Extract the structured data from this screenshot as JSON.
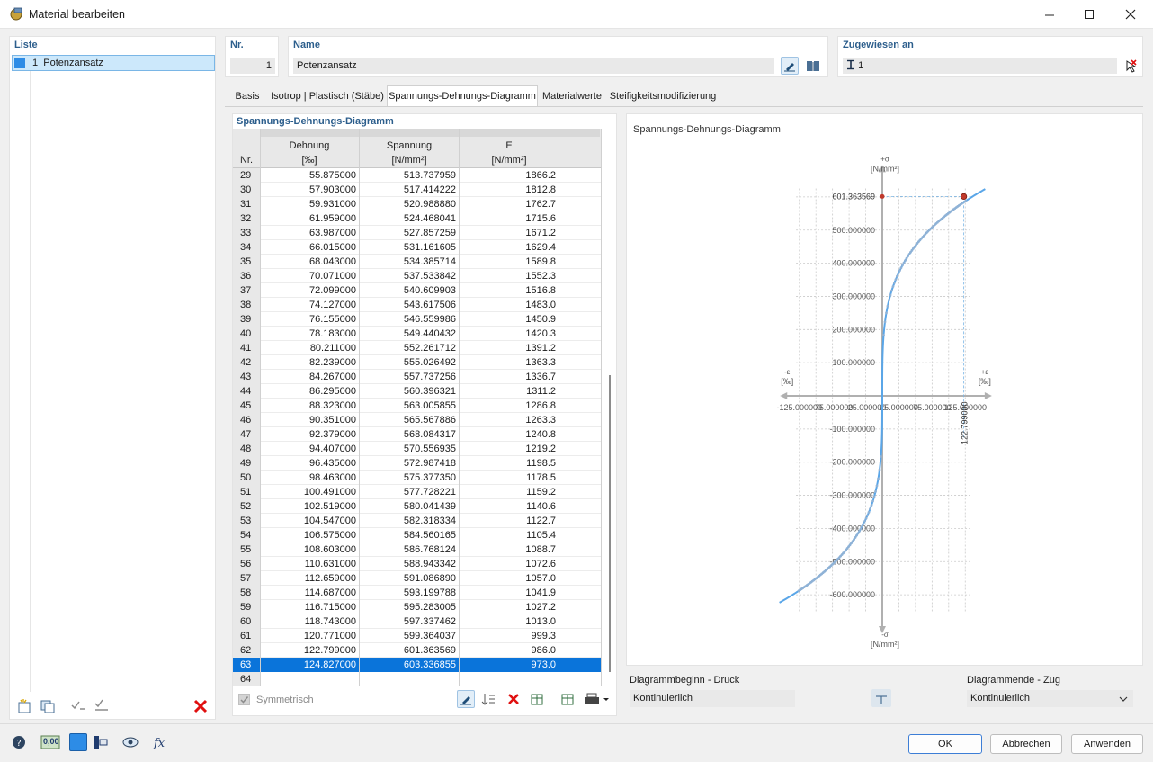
{
  "window": {
    "title": "Material bearbeiten"
  },
  "list": {
    "title": "Liste",
    "items": [
      {
        "nr": "1",
        "label": "Potenzansatz"
      }
    ]
  },
  "header": {
    "nr_label": "Nr.",
    "nr_value": "1",
    "name_label": "Name",
    "name_value": "Potenzansatz",
    "assigned_label": "Zugewiesen an",
    "assigned_value": "1"
  },
  "tabs": [
    {
      "label": "Basis",
      "active": false
    },
    {
      "label": "Isotrop | Plastisch (Stäbe)",
      "active": false
    },
    {
      "label": "Spannungs-Dehnungs-Diagramm",
      "active": true
    },
    {
      "label": "Materialwerte",
      "active": false
    },
    {
      "label": "Steifigkeitsmodifizierung",
      "active": false
    }
  ],
  "table": {
    "title": "Spannungs-Dehnungs-Diagramm",
    "headers": {
      "nr": "Nr.",
      "strain": "Dehnung",
      "strain_unit": "[‰]",
      "stress": "Spannung",
      "stress_unit": "[N/mm²]",
      "modulus": "E",
      "modulus_unit": "[N/mm²]"
    },
    "selected_row": "63",
    "rows": [
      [
        "29",
        "55.875000",
        "513.737959",
        "1866.2"
      ],
      [
        "30",
        "57.903000",
        "517.414222",
        "1812.8"
      ],
      [
        "31",
        "59.931000",
        "520.988880",
        "1762.7"
      ],
      [
        "32",
        "61.959000",
        "524.468041",
        "1715.6"
      ],
      [
        "33",
        "63.987000",
        "527.857259",
        "1671.2"
      ],
      [
        "34",
        "66.015000",
        "531.161605",
        "1629.4"
      ],
      [
        "35",
        "68.043000",
        "534.385714",
        "1589.8"
      ],
      [
        "36",
        "70.071000",
        "537.533842",
        "1552.3"
      ],
      [
        "37",
        "72.099000",
        "540.609903",
        "1516.8"
      ],
      [
        "38",
        "74.127000",
        "543.617506",
        "1483.0"
      ],
      [
        "39",
        "76.155000",
        "546.559986",
        "1450.9"
      ],
      [
        "40",
        "78.183000",
        "549.440432",
        "1420.3"
      ],
      [
        "41",
        "80.211000",
        "552.261712",
        "1391.2"
      ],
      [
        "42",
        "82.239000",
        "555.026492",
        "1363.3"
      ],
      [
        "43",
        "84.267000",
        "557.737256",
        "1336.7"
      ],
      [
        "44",
        "86.295000",
        "560.396321",
        "1311.2"
      ],
      [
        "45",
        "88.323000",
        "563.005855",
        "1286.8"
      ],
      [
        "46",
        "90.351000",
        "565.567886",
        "1263.3"
      ],
      [
        "47",
        "92.379000",
        "568.084317",
        "1240.8"
      ],
      [
        "48",
        "94.407000",
        "570.556935",
        "1219.2"
      ],
      [
        "49",
        "96.435000",
        "572.987418",
        "1198.5"
      ],
      [
        "50",
        "98.463000",
        "575.377350",
        "1178.5"
      ],
      [
        "51",
        "100.491000",
        "577.728221",
        "1159.2"
      ],
      [
        "52",
        "102.519000",
        "580.041439",
        "1140.6"
      ],
      [
        "53",
        "104.547000",
        "582.318334",
        "1122.7"
      ],
      [
        "54",
        "106.575000",
        "584.560165",
        "1105.4"
      ],
      [
        "55",
        "108.603000",
        "586.768124",
        "1088.7"
      ],
      [
        "56",
        "110.631000",
        "588.943342",
        "1072.6"
      ],
      [
        "57",
        "112.659000",
        "591.086890",
        "1057.0"
      ],
      [
        "58",
        "114.687000",
        "593.199788",
        "1041.9"
      ],
      [
        "59",
        "116.715000",
        "595.283005",
        "1027.2"
      ],
      [
        "60",
        "118.743000",
        "597.337462",
        "1013.0"
      ],
      [
        "61",
        "120.771000",
        "599.364037",
        "999.3"
      ],
      [
        "62",
        "122.799000",
        "601.363569",
        "986.0"
      ],
      [
        "63",
        "124.827000",
        "603.336855",
        "973.0"
      ],
      [
        "64",
        "",
        "",
        ""
      ]
    ],
    "symmetric_label": "Symmetrisch"
  },
  "chart_data": {
    "type": "line",
    "title": "Spannungs-Dehnungs-Diagramm",
    "x_axis_pos_label": "+ε",
    "x_axis_neg_label": "-ε",
    "x_unit": "[‰]",
    "y_axis_pos_label": "+σ",
    "y_axis_neg_label": "-σ",
    "y_unit": "[N/mm²]",
    "x_ticks": [
      "-125.000000",
      "-75.000000",
      "-25.000000",
      "25.000000",
      "75.000000",
      "125.000000"
    ],
    "y_ticks": [
      "-600.000000",
      "-500.000000",
      "-400.000000",
      "-300.000000",
      "-200.000000",
      "-100.000000",
      "100.000000",
      "200.000000",
      "300.000000",
      "400.000000",
      "500.000000"
    ],
    "highlight": {
      "x": 122.799,
      "y": 601.363569,
      "x_label": "122.799000",
      "y_label": "601.363569"
    },
    "xlim": [
      -146,
      159
    ],
    "ylim": [
      -700,
      690
    ],
    "grid": true,
    "curve": {
      "type": "power",
      "a": 150,
      "n": 0.2826
    },
    "series": [
      {
        "color": "#5aa6e8"
      }
    ]
  },
  "diagram": {
    "begin_label": "Diagrammbeginn - Druck",
    "begin_value": "Kontinuierlich",
    "end_label": "Diagrammende - Zug",
    "end_value": "Kontinuierlich"
  },
  "buttons": {
    "ok": "OK",
    "cancel": "Abbrechen",
    "apply": "Anwenden"
  },
  "bottom_tools": {
    "units_label": "0,00"
  }
}
